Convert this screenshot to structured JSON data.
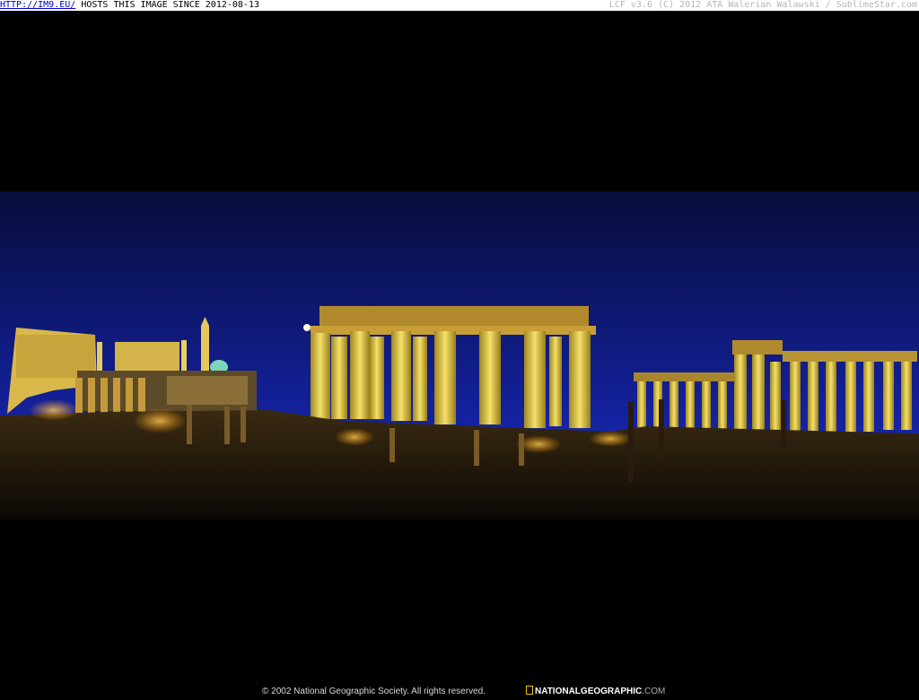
{
  "topbar": {
    "host_link": "HTTP://IM9.EU/",
    "host_text": " HOSTS THIS IMAGE SINCE 2012-08-13",
    "credit": "LCF v3.6 (C) 2012 ATA Walerian Walawski / SublimeStar.com"
  },
  "footer": {
    "copyright": "© 2002 National Geographic Society. All rights reserved.",
    "brand": "NATIONALGEOGRAPHIC",
    "brand_suffix": ".COM"
  },
  "colors": {
    "sky_top": "#0a1140",
    "sky_bottom": "#1a2aa8",
    "stone_lit": "#e8d25a",
    "ground": "#1a1208"
  }
}
